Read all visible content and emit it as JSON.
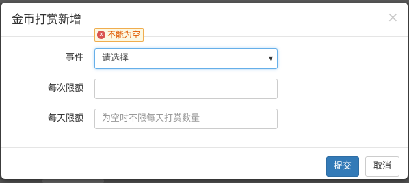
{
  "modal": {
    "title": "金币打赏新增",
    "close_symbol": "×"
  },
  "form": {
    "event": {
      "label": "事件",
      "selected_value": "请选择",
      "error_message": "不能为空",
      "error_icon": "error-x-icon"
    },
    "per_time_limit": {
      "label": "每次限额",
      "value": "",
      "placeholder": ""
    },
    "per_day_limit": {
      "label": "每天限额",
      "value": "",
      "placeholder": "为空时不限每天打赏数量"
    }
  },
  "footer": {
    "submit_label": "提交",
    "cancel_label": "取消"
  },
  "colors": {
    "primary": "#337ab7",
    "focus_border": "#66afe9",
    "error_text": "#e05a00",
    "error_bg": "#fcf8e3"
  }
}
